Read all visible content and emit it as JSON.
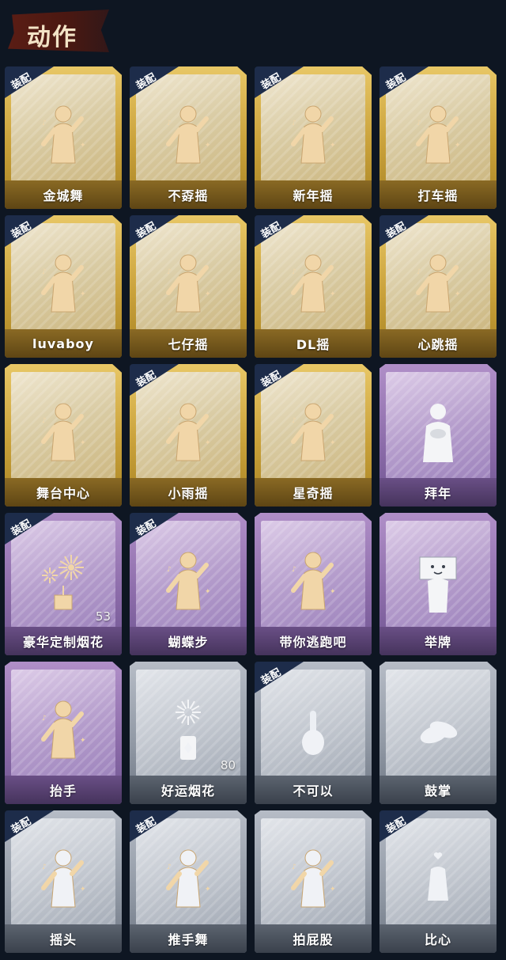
{
  "header": {
    "title": "动作"
  },
  "equip_label": "装配",
  "cards": [
    {
      "label": "金城舞",
      "tier": "gold",
      "equipped": true,
      "icon": "dance-figure-icon"
    },
    {
      "label": "不孬摇",
      "tier": "gold",
      "equipped": true,
      "icon": "dance-figure-icon"
    },
    {
      "label": "新年摇",
      "tier": "gold",
      "equipped": true,
      "icon": "dance-figure-icon"
    },
    {
      "label": "打车摇",
      "tier": "gold",
      "equipped": true,
      "icon": "dance-figure-icon"
    },
    {
      "label": "luvaboy",
      "tier": "gold",
      "equipped": true,
      "icon": "dance-figure-icon"
    },
    {
      "label": "七仔摇",
      "tier": "gold",
      "equipped": true,
      "icon": "dance-figure-icon"
    },
    {
      "label": "DL摇",
      "tier": "gold",
      "equipped": true,
      "icon": "dance-figure-icon"
    },
    {
      "label": "心跳摇",
      "tier": "gold",
      "equipped": true,
      "icon": "dance-figure-icon"
    },
    {
      "label": "舞台中心",
      "tier": "gold",
      "equipped": false,
      "icon": "dance-figure-icon"
    },
    {
      "label": "小雨摇",
      "tier": "gold",
      "equipped": true,
      "icon": "dance-figure-icon"
    },
    {
      "label": "星奇摇",
      "tier": "gold",
      "equipped": true,
      "icon": "dance-figure-icon"
    },
    {
      "label": "拜年",
      "tier": "purple",
      "equipped": false,
      "icon": "greeting-figure-icon"
    },
    {
      "label": "豪华定制烟花",
      "tier": "purple",
      "equipped": true,
      "icon": "fireworks-icon",
      "count": "53"
    },
    {
      "label": "蝴蝶步",
      "tier": "purple",
      "equipped": true,
      "icon": "dance-figure-icon"
    },
    {
      "label": "带你逃跑吧",
      "tier": "purple",
      "equipped": false,
      "icon": "dance-figure-icon"
    },
    {
      "label": "举牌",
      "tier": "purple",
      "equipped": false,
      "icon": "sign-figure-icon"
    },
    {
      "label": "抬手",
      "tier": "purple",
      "equipped": false,
      "icon": "dance-figure-icon"
    },
    {
      "label": "好运烟花",
      "tier": "silver",
      "equipped": false,
      "icon": "firework-can-icon",
      "count": "80"
    },
    {
      "label": "不可以",
      "tier": "silver",
      "equipped": true,
      "icon": "finger-wag-icon"
    },
    {
      "label": "鼓掌",
      "tier": "silver",
      "equipped": false,
      "icon": "clap-hands-icon"
    },
    {
      "label": "摇头",
      "tier": "silver",
      "equipped": true,
      "icon": "dance-figure-icon"
    },
    {
      "label": "推手舞",
      "tier": "silver",
      "equipped": true,
      "icon": "dance-figure-icon"
    },
    {
      "label": "拍屁股",
      "tier": "silver",
      "equipped": false,
      "icon": "dance-figure-icon"
    },
    {
      "label": "比心",
      "tier": "silver",
      "equipped": true,
      "icon": "heart-hand-icon"
    }
  ]
}
